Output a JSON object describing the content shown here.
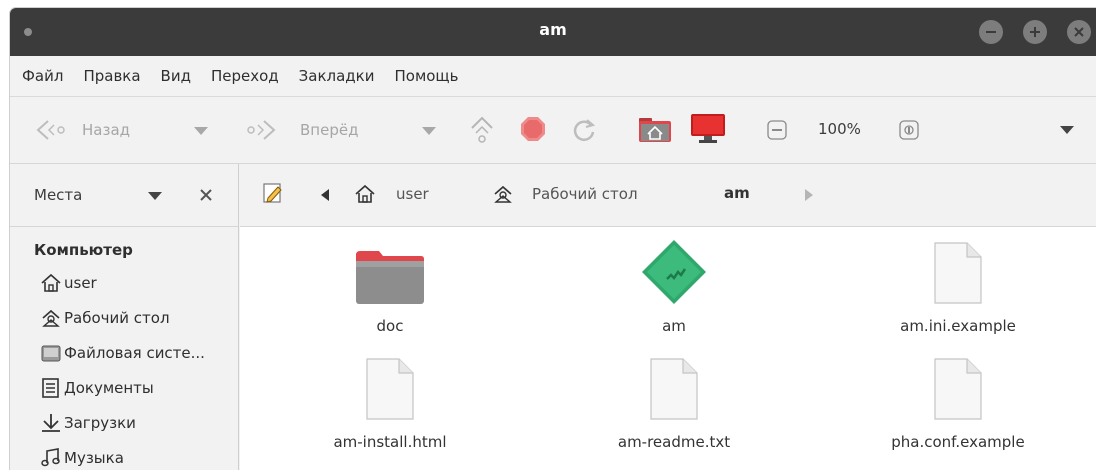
{
  "window": {
    "title": "am"
  },
  "menubar": {
    "items": [
      "Файл",
      "Правка",
      "Вид",
      "Переход",
      "Закладки",
      "Помощь"
    ]
  },
  "toolbar": {
    "back_label": "Назад",
    "forward_label": "Вперёд",
    "zoom_level": "100%"
  },
  "sidebar": {
    "header_label": "Места",
    "section_title": "Компьютер",
    "items": [
      {
        "label": "user",
        "icon": "home-icon"
      },
      {
        "label": "Рабочий стол",
        "icon": "desktop-icon"
      },
      {
        "label": "Файловая систе...",
        "icon": "filesystem-icon"
      },
      {
        "label": "Документы",
        "icon": "documents-icon"
      },
      {
        "label": "Загрузки",
        "icon": "downloads-icon"
      },
      {
        "label": "Музыка",
        "icon": "music-icon"
      }
    ]
  },
  "pathbar": {
    "crumbs": [
      "user",
      "Рабочий стол",
      "am"
    ]
  },
  "files": [
    {
      "name": "doc",
      "type": "folder"
    },
    {
      "name": "am",
      "type": "executable"
    },
    {
      "name": "am.ini.example",
      "type": "text"
    },
    {
      "name": "am-install.html",
      "type": "text"
    },
    {
      "name": "am-readme.txt",
      "type": "text"
    },
    {
      "name": "pha.conf.example",
      "type": "text"
    }
  ],
  "colors": {
    "titlebar": "#3b3b3b",
    "folder_red": "#e0474c",
    "exec_green": "#2ea86b",
    "stop_red": "#e05050"
  }
}
